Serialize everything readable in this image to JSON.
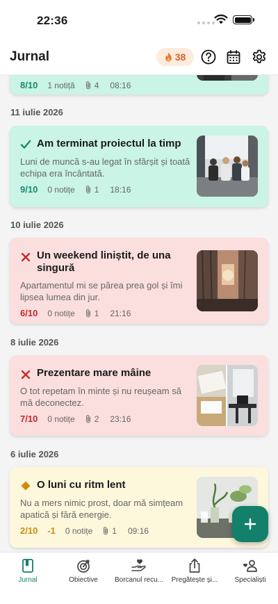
{
  "status_bar": {
    "time": "22:36"
  },
  "header": {
    "title": "Jurnal",
    "streak_count": "38",
    "icons": [
      "help-icon",
      "calendar-icon",
      "settings-icon"
    ]
  },
  "entries": [
    {
      "date": "",
      "title": "",
      "body": "",
      "score": "8/10",
      "notes": "1 notiță",
      "attachments": "4",
      "time": "08:16",
      "mood": "positive"
    },
    {
      "date": "11 iulie 2026",
      "title": "Am terminat proiectul la timp",
      "body": "Luni de muncă s-au legat în sfârșit și toată echipa era încântată.",
      "score": "9/10",
      "notes": "0 notițe",
      "attachments": "1",
      "time": "18:16",
      "mood": "positive"
    },
    {
      "date": "10 iulie 2026",
      "title": "Un weekend liniștit, de una singură",
      "body": "Apartamentul mi se părea prea gol și îmi lipsea lumea din jur.",
      "score": "6/10",
      "notes": "0 notițe",
      "attachments": "1",
      "time": "21:16",
      "mood": "negative"
    },
    {
      "date": "8 iulie 2026",
      "title": "Prezentare mare mâine",
      "body": "O tot repetam în minte și nu reușeam să mă deconectez.",
      "score": "7/10",
      "notes": "0 notițe",
      "attachments": "2",
      "time": "23:16",
      "mood": "negative"
    },
    {
      "date": "6 iulie 2026",
      "title": "O luni cu ritm lent",
      "body": "Nu a mers nimic prost, doar mă simțeam apatică și fără energie.",
      "score": "2/10",
      "delta": "-1",
      "notes": "0 notițe",
      "attachments": "1",
      "time": "09:16",
      "mood": "neutral"
    }
  ],
  "colors": {
    "accent": "#13806b",
    "positive_bg": "#c9f4e6",
    "negative_bg": "#fbdede",
    "neutral_bg": "#fdf7dc",
    "streak": "#d9622b"
  },
  "fab": {
    "icon": "plus-icon"
  },
  "tabs": [
    {
      "label": "Jurnal",
      "icon": "journal-icon",
      "active": true
    },
    {
      "label": "Obiective",
      "icon": "target-icon",
      "active": false
    },
    {
      "label": "Borcanul recu...",
      "icon": "heart-hand-icon",
      "active": false
    },
    {
      "label": "Pregătește și...",
      "icon": "share-icon",
      "active": false
    },
    {
      "label": "Specialiști",
      "icon": "specialists-icon",
      "active": false
    }
  ]
}
